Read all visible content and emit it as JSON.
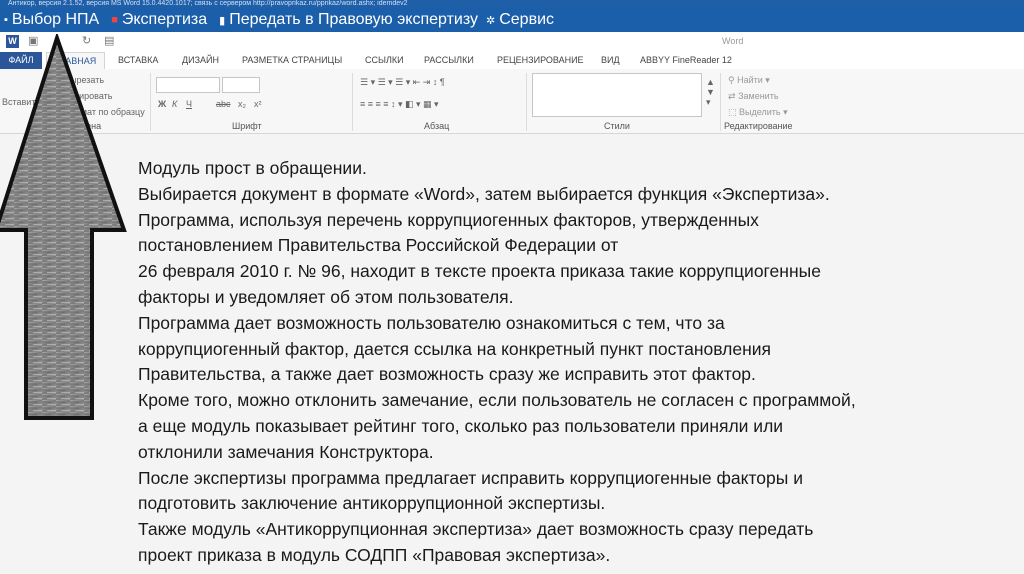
{
  "title_bar": {
    "text": "Антикор, версия 2.1.52, версия MS Word 15.0.4420.1017; связь с сервером http://pravoprikaz.ru/pprikaz/word.ashx; idemdev2"
  },
  "addin_bar": {
    "items": [
      {
        "label": "Выбор НПА"
      },
      {
        "label": "Экспертиза"
      },
      {
        "label": "Передать в Правовую экспертизу"
      },
      {
        "label": "Сервис"
      }
    ]
  },
  "document_title": "Word",
  "ribbon_tabs": [
    "ФАЙЛ",
    "ГЛАВНАЯ",
    "ВСТАВКА",
    "ДИЗАЙН",
    "РАЗМЕТКА СТРАНИЦЫ",
    "ССЫЛКИ",
    "РАССЫЛКИ",
    "РЕЦЕНЗИРОВАНИЕ",
    "ВИД",
    "ABBYY FineReader 12"
  ],
  "ribbon": {
    "clipboard": {
      "paste": "Вставить",
      "cut": "Вырезать",
      "copy": "Копировать",
      "format": "Формат по образцу",
      "label": "Буфер обмена"
    },
    "font": {
      "bold": "Ж",
      "italic": "К",
      "underline": "Ч",
      "strike": "abc",
      "sub": "x₂",
      "sup": "x²",
      "label": "Шрифт"
    },
    "paragraph": {
      "label": "Абзац"
    },
    "styles": {
      "label": "Стили"
    },
    "editing": {
      "find": "Найти",
      "replace": "Заменить",
      "select": "Выделить",
      "label": "Редактирование"
    }
  },
  "body_lines": [
    "Модуль прост в обращении.",
    "Выбирается документ в формате «Word», затем выбирается функция «Экспертиза».",
    "Программа, используя перечень коррупциогенных факторов, утвержденных",
    "постановлением Правительства Российской Федерации от",
    "26 февраля 2010 г. № 96, находит в тексте проекта приказа такие коррупциогенные",
    "факторы и уведомляет об этом пользователя.",
    "Программа дает возможность пользователю ознакомиться с тем, что за",
    "коррупциогенный фактор, дается ссылка на конкретный пункт постановления",
    "Правительства, а также дает возможность сразу же исправить этот фактор.",
    "Кроме того, можно отклонить замечание, если пользователь не согласен с программой,",
    "а еще модуль показывает рейтинг того, сколько раз пользователи приняли или",
    "отклонили замечания Конструктора.",
    "После экспертизы программа предлагает исправить коррупциогенные факторы и",
    "подготовить заключение антикоррупционной экспертизы.",
    "Также модуль «Антикоррупционная экспертиза» дает возможность сразу передать",
    "проект приказа в модуль СОДПП «Правовая экспертиза»."
  ],
  "colors": {
    "addin_bar": "#1b5faa",
    "file_tab": "#2b579a",
    "arrow": "#8a8a8a"
  }
}
